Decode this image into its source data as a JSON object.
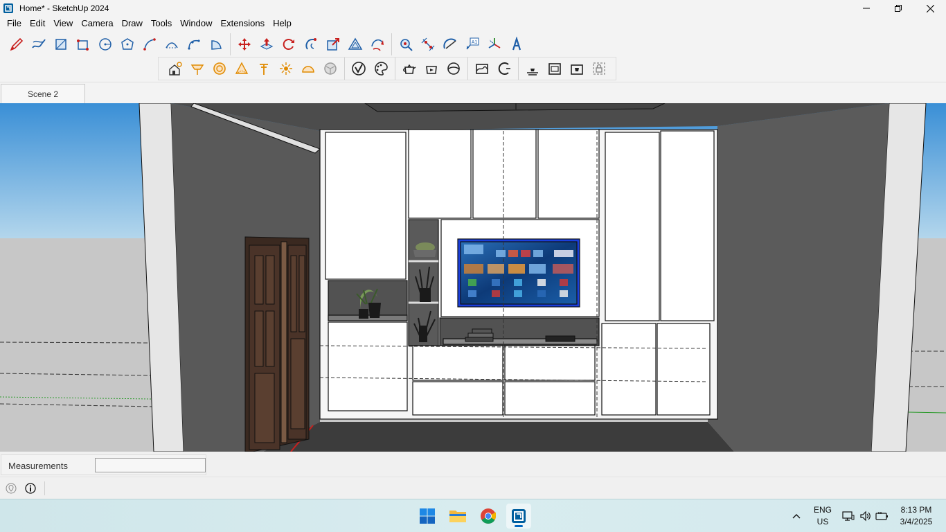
{
  "window": {
    "title": "Home* - SketchUp 2024",
    "controls": [
      "minimize-icon",
      "restore-icon",
      "close-icon"
    ]
  },
  "menu": {
    "items": [
      "File",
      "Edit",
      "View",
      "Camera",
      "Draw",
      "Tools",
      "Window",
      "Extensions",
      "Help"
    ]
  },
  "toolbar": {
    "row1": [
      {
        "name": "line-tool",
        "icon": "pencil-icon"
      },
      {
        "name": "freehand-tool",
        "icon": "freehand-icon"
      },
      {
        "name": "rectangle-tool",
        "icon": "rectangle-icon"
      },
      {
        "name": "rotated-rectangle-tool",
        "icon": "rotated-rectangle-icon"
      },
      {
        "name": "circle-tool",
        "icon": "circle-icon"
      },
      {
        "name": "polygon-tool",
        "icon": "polygon-icon"
      },
      {
        "name": "arc-tool",
        "icon": "arc-icon"
      },
      {
        "name": "two-point-arc-tool",
        "icon": "two-point-arc-icon"
      },
      {
        "name": "three-point-arc-tool",
        "icon": "three-point-arc-icon"
      },
      {
        "name": "pie-tool",
        "icon": "pie-icon"
      },
      {
        "name": "move-tool",
        "icon": "move-icon"
      },
      {
        "name": "push-pull-tool",
        "icon": "push-pull-icon"
      },
      {
        "name": "rotate-tool",
        "icon": "rotate-icon"
      },
      {
        "name": "follow-me-tool",
        "icon": "follow-me-icon"
      },
      {
        "name": "scale-tool",
        "icon": "scale-icon"
      },
      {
        "name": "offset-tool",
        "icon": "offset-icon"
      },
      {
        "name": "flip-tool",
        "icon": "flip-icon"
      },
      {
        "name": "tape-measure-tool",
        "icon": "tape-measure-icon"
      },
      {
        "name": "dimension-tool",
        "icon": "dimension-icon"
      },
      {
        "name": "protractor-tool",
        "icon": "protractor-icon"
      },
      {
        "name": "text-tool",
        "icon": "text-label-icon"
      },
      {
        "name": "axes-tool",
        "icon": "axes-icon"
      },
      {
        "name": "3d-text-tool",
        "icon": "3d-text-icon"
      }
    ],
    "row2": [
      {
        "name": "styles-button",
        "icon": "house-sun-icon"
      },
      {
        "name": "section-plane-button",
        "icon": "section-plane-icon"
      },
      {
        "name": "xray-button",
        "icon": "xray-icon"
      },
      {
        "name": "back-edges-button",
        "icon": "back-edges-icon"
      },
      {
        "name": "wireframe-button",
        "icon": "wireframe-icon"
      },
      {
        "name": "hidden-line-button",
        "icon": "hidden-line-icon"
      },
      {
        "name": "shaded-button",
        "icon": "shaded-icon"
      },
      {
        "name": "shaded-textures-button",
        "icon": "shaded-textures-icon"
      },
      {
        "name": "monochrome-button",
        "icon": "monochrome-icon"
      },
      {
        "name": "solid-tools-button",
        "icon": "solid-tools-icon"
      },
      {
        "name": "color-by-layer-button",
        "icon": "color-palette-icon"
      },
      {
        "name": "warehouse-button",
        "icon": "teapot-icon"
      },
      {
        "name": "share-model-button",
        "icon": "share-model-icon"
      },
      {
        "name": "ext-warehouse-button",
        "icon": "extension-warehouse-icon"
      },
      {
        "name": "sandbox-button",
        "icon": "sandbox-icon"
      },
      {
        "name": "sandbox-contours-button",
        "icon": "sandbox-contours-icon"
      },
      {
        "name": "model-info-button",
        "icon": "model-info-icon"
      },
      {
        "name": "lock-button",
        "icon": "lock-icon"
      }
    ]
  },
  "scenes": {
    "tabs": [
      "Scene 2"
    ]
  },
  "measurements": {
    "label": "Measurements",
    "value": ""
  },
  "taskbar": {
    "apps": [
      "windows-start-icon",
      "file-explorer-icon",
      "chrome-icon",
      "sketchup-icon"
    ],
    "lang_top": "ENG",
    "lang_bottom": "US",
    "time": "8:13 PM",
    "date": "3/4/2025"
  },
  "colors": {
    "sky_top": "#3a8fd6",
    "sky_bottom": "#b3d6ec",
    "ground": "#c7c7c7",
    "wall": "#595959",
    "cabinet": "#ffffff",
    "door": "#4a3328",
    "floor": "#3c3c3c",
    "tv_frame": "#1a3fdc",
    "accent_blue": "#0067c0"
  }
}
